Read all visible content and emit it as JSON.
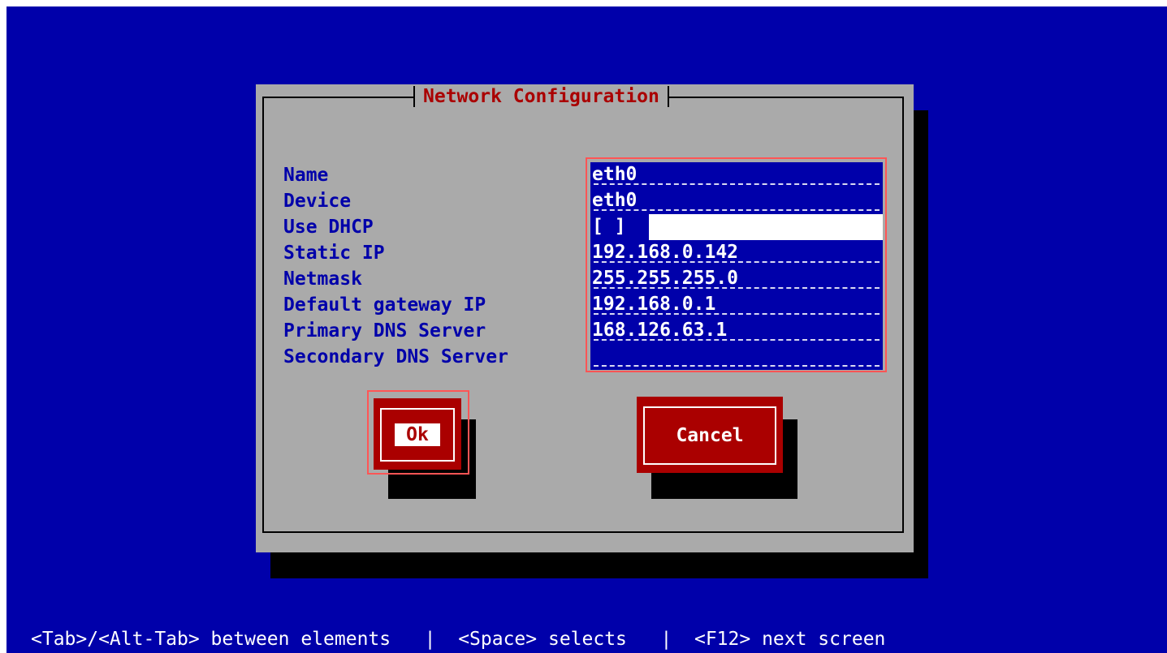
{
  "dialog": {
    "title": "Network Configuration",
    "fields": [
      {
        "label": "Name",
        "value": "eth0"
      },
      {
        "label": "Device",
        "value": "eth0"
      },
      {
        "label": "Use DHCP",
        "value": "[ ]"
      },
      {
        "label": "Static IP",
        "value": "192.168.0.142"
      },
      {
        "label": "Netmask",
        "value": "255.255.255.0"
      },
      {
        "label": "Default gateway IP",
        "value": "192.168.0.1"
      },
      {
        "label": "Primary DNS Server",
        "value": "168.126.63.1"
      },
      {
        "label": "Secondary DNS Server",
        "value": ""
      }
    ],
    "ok_label": "Ok",
    "cancel_label": "Cancel"
  },
  "helpbar": {
    "text": "<Tab>/<Alt-Tab> between elements   |  <Space> selects   |  <F12> next screen"
  },
  "colors": {
    "background": "#0000aa",
    "dialog": "#aaaaaa",
    "accent": "#aa0000",
    "focus": "#ff5555"
  }
}
